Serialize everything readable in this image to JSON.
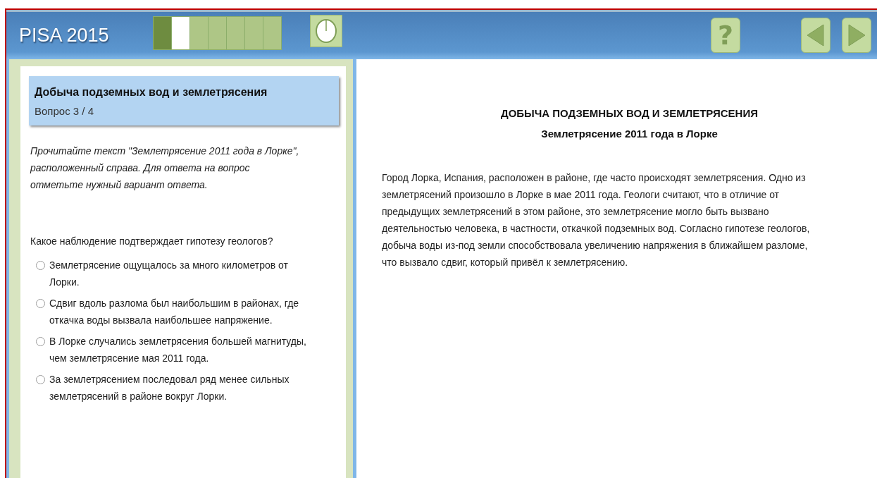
{
  "header": {
    "title": "PISA 2015",
    "progress": [
      {
        "done": true,
        "current": false
      },
      {
        "done": false,
        "current": true
      },
      {
        "done": false,
        "current": false
      },
      {
        "done": false,
        "current": false
      },
      {
        "done": false,
        "current": false
      },
      {
        "done": false,
        "current": false
      },
      {
        "done": false,
        "current": false
      }
    ],
    "help_label": "?"
  },
  "question_panel": {
    "unit_title": "Добыча подземных вод и землетрясения",
    "question_number": "Вопрос 3 / 4",
    "instruction": "Прочитайте текст \"Землетрясение 2011 года в Лорке\", расположенный справа. Для ответа на вопрос отметьте нужный вариант ответа.",
    "question": "Какое наблюдение подтверждает гипотезу геологов?",
    "options": [
      {
        "text": "Землетрясение ощущалось за много километров от Лорки.",
        "selected": false
      },
      {
        "text": "Сдвиг вдоль разлома был наибольшим в районах, где откачка воды вызвала наибольшее напряжение.",
        "selected": false
      },
      {
        "text": "В Лорке случались землетрясения большей магнитуды, чем землетрясение мая 2011 года.",
        "selected": false
      },
      {
        "text": "За землетрясением последовал ряд менее сильных землетрясений в районе вокруг Лорки.",
        "selected": false
      }
    ]
  },
  "stimulus": {
    "title": "ДОБЫЧА ПОДЗЕМНЫХ ВОД И ЗЕМЛЕТРЯСЕНИЯ",
    "subtitle": "Землетрясение 2011 года в Лорке",
    "body": "Город Лорка, Испания, расположен в районе, где часто происходят землетрясения. Одно из землетрясений произошло в Лорке в мае 2011 года. Геологи считают, что в отличие от предыдущих землетрясений в этом районе, это землетрясение могло быть вызвано деятельностью человека, в частности, откачкой подземных вод. Согласно гипотезе геологов, добыча воды из-под земли способствовала увеличению напряжения в ближайшем разломе, что вызвало сдвиг, который привёл к землетрясению."
  }
}
